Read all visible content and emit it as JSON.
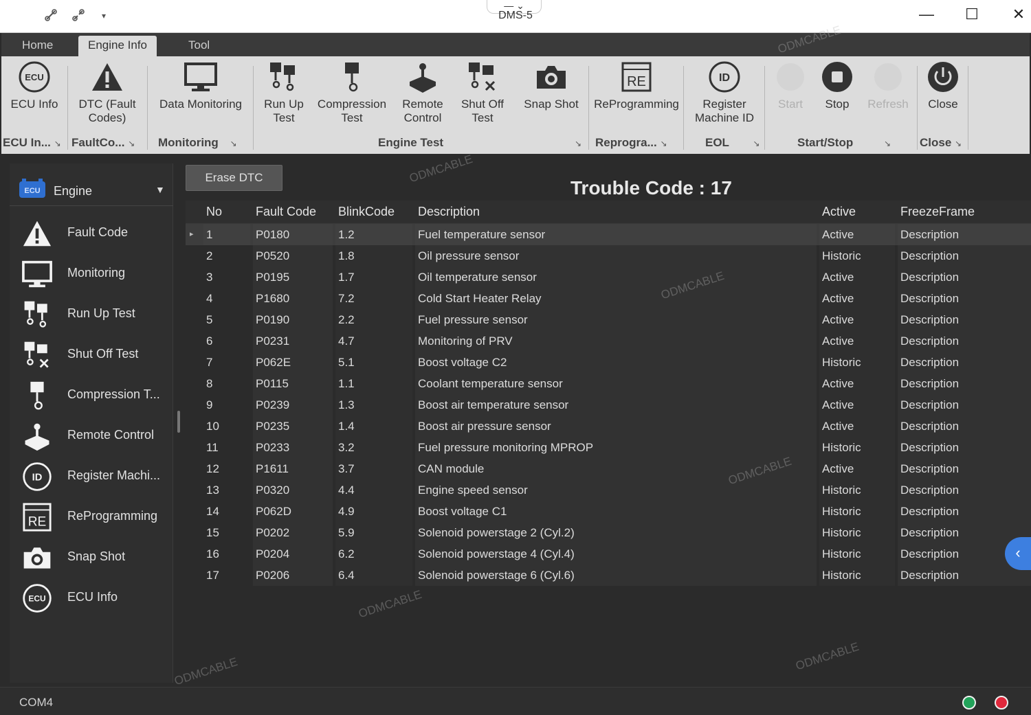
{
  "window": {
    "title": "DMS-5",
    "controls": {
      "minimize": "—",
      "maximize": "☐",
      "close": "✕"
    }
  },
  "ribbon_tabs": [
    {
      "label": "Home"
    },
    {
      "label": "Engine Info"
    },
    {
      "label": "Tool"
    }
  ],
  "ribbon": {
    "buttons": {
      "ecu_info": {
        "line1": "ECU Info",
        "line2": ""
      },
      "dtc": {
        "line1": "DTC (Fault",
        "line2": "Codes)"
      },
      "data_monitoring": {
        "line1": "Data Monitoring",
        "line2": ""
      },
      "run_up": {
        "line1": "Run Up",
        "line2": "Test"
      },
      "compression": {
        "line1": "Compression",
        "line2": "Test"
      },
      "remote": {
        "line1": "Remote",
        "line2": "Control"
      },
      "shut_off": {
        "line1": "Shut Off",
        "line2": "Test"
      },
      "snap_shot": {
        "line1": "Snap Shot",
        "line2": ""
      },
      "reprograming": {
        "line1": "ReProgramming",
        "line2": ""
      },
      "register": {
        "line1": "Register",
        "line2": "Machine ID"
      },
      "start": {
        "line1": "Start",
        "line2": ""
      },
      "stop": {
        "line1": "Stop",
        "line2": ""
      },
      "refresh": {
        "line1": "Refresh",
        "line2": ""
      },
      "close": {
        "line1": "Close",
        "line2": ""
      }
    },
    "groups": {
      "ecu": "ECU In...",
      "fault": "FaultCo...",
      "monitoring": "Monitoring",
      "engine_test": "Engine Test",
      "reprogra": "Reprogra...",
      "eol": "EOL",
      "start_stop": "Start/Stop",
      "close": "Close"
    },
    "launcher_glyph": "↘",
    "ecu_icon_text": "ECU",
    "id_icon_text": "ID",
    "re_icon_text": "RE"
  },
  "sidebar": {
    "header": "Engine",
    "header_icon_text": "ECU",
    "items": [
      {
        "label": "Fault Code"
      },
      {
        "label": "Monitoring"
      },
      {
        "label": "Run Up Test"
      },
      {
        "label": "Shut Off Test"
      },
      {
        "label": "Compression T..."
      },
      {
        "label": "Remote Control"
      },
      {
        "label": "Register Machi..."
      },
      {
        "label": "ReProgramming"
      },
      {
        "label": "Snap Shot"
      },
      {
        "label": "ECU Info"
      }
    ]
  },
  "main": {
    "erase_button": "Erase DTC",
    "trouble_code_label": "Trouble Code : 17",
    "columns": {
      "no": "No",
      "fault_code": "Fault Code",
      "blink_code": "BlinkCode",
      "description": "Description",
      "active": "Active",
      "freeze_frame": "FreezeFrame"
    },
    "selected_marker": "▸",
    "rows": [
      {
        "no": "1",
        "fault": "P0180",
        "blink": "1.2",
        "desc": "Fuel temperature sensor",
        "active": "Active",
        "freeze": "Description"
      },
      {
        "no": "2",
        "fault": "P0520",
        "blink": "1.8",
        "desc": "Oil pressure sensor",
        "active": "Historic",
        "freeze": "Description"
      },
      {
        "no": "3",
        "fault": "P0195",
        "blink": "1.7",
        "desc": "Oil temperature sensor",
        "active": "Active",
        "freeze": "Description"
      },
      {
        "no": "4",
        "fault": "P1680",
        "blink": "7.2",
        "desc": "Cold Start Heater Relay",
        "active": "Active",
        "freeze": "Description"
      },
      {
        "no": "5",
        "fault": "P0190",
        "blink": "2.2",
        "desc": "Fuel pressure sensor",
        "active": "Active",
        "freeze": "Description"
      },
      {
        "no": "6",
        "fault": "P0231",
        "blink": "4.7",
        "desc": "Monitoring of PRV",
        "active": "Active",
        "freeze": "Description"
      },
      {
        "no": "7",
        "fault": "P062E",
        "blink": "5.1",
        "desc": "Boost voltage C2",
        "active": "Historic",
        "freeze": "Description"
      },
      {
        "no": "8",
        "fault": "P0115",
        "blink": "1.1",
        "desc": "Coolant temperature sensor",
        "active": "Active",
        "freeze": "Description"
      },
      {
        "no": "9",
        "fault": "P0239",
        "blink": "1.3",
        "desc": "Boost air temperature sensor",
        "active": "Active",
        "freeze": "Description"
      },
      {
        "no": "10",
        "fault": "P0235",
        "blink": "1.4",
        "desc": "Boost air pressure sensor",
        "active": "Active",
        "freeze": "Description"
      },
      {
        "no": "11",
        "fault": "P0233",
        "blink": "3.2",
        "desc": "Fuel pressure monitoring MPROP",
        "active": "Historic",
        "freeze": "Description"
      },
      {
        "no": "12",
        "fault": "P1611",
        "blink": "3.7",
        "desc": "CAN module",
        "active": "Active",
        "freeze": "Description"
      },
      {
        "no": "13",
        "fault": "P0320",
        "blink": "4.4",
        "desc": "Engine speed sensor",
        "active": "Historic",
        "freeze": "Description"
      },
      {
        "no": "14",
        "fault": "P062D",
        "blink": "4.9",
        "desc": "Boost voltage C1",
        "active": "Historic",
        "freeze": "Description"
      },
      {
        "no": "15",
        "fault": "P0202",
        "blink": "5.9",
        "desc": "Solenoid powerstage 2 (Cyl.2)",
        "active": "Historic",
        "freeze": "Description"
      },
      {
        "no": "16",
        "fault": "P0204",
        "blink": "6.2",
        "desc": "Solenoid powerstage 4 (Cyl.4)",
        "active": "Historic",
        "freeze": "Description"
      },
      {
        "no": "17",
        "fault": "P0206",
        "blink": "6.4",
        "desc": "Solenoid powerstage 6 (Cyl.6)",
        "active": "Historic",
        "freeze": "Description"
      }
    ]
  },
  "status": {
    "port": "COM4",
    "indicator_colors": {
      "ok": "#22a35a",
      "error": "#e0283c"
    },
    "panel_toggle_glyph": "‹"
  },
  "watermark": "ODMCABLE",
  "colors": {
    "accent": "#3d7fe0",
    "ribbon_bg": "#dcdcdc",
    "app_bg": "#2b2b2b"
  }
}
